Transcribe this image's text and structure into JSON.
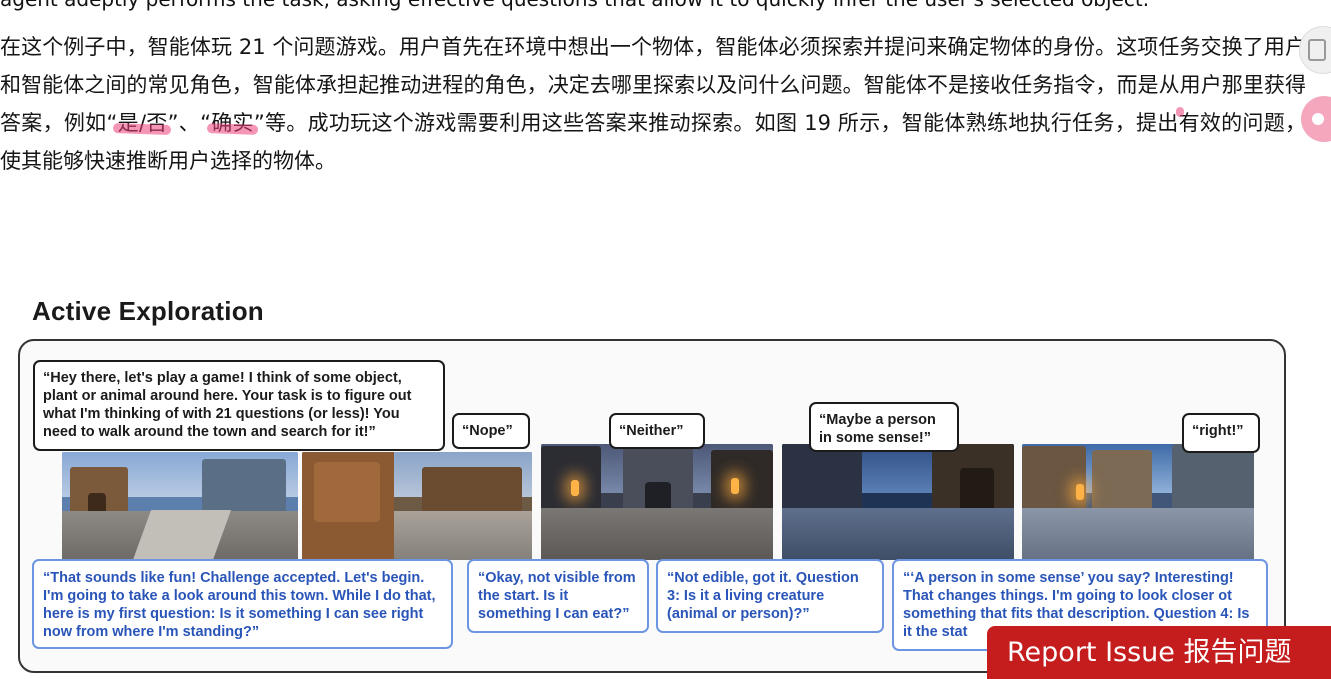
{
  "article": {
    "cut_line": "agent adeptly performs the task, asking effective questions that allow it to quickly infer the user's selected object.",
    "para_1": "在这个例子中，智能体玩 21 个问题游戏。用户首先在环境中想出一个物体，智能体必须探索并提问来确定物体的身份。这项任务交换了用户和智能体之间的常见角色，智能体承担起推动进程的角色，决定去哪里探索以及问什么问题。智能体不是接收任务指令，而是从",
    "para_hl_1": "用户那里获得答案",
    "para_2": "，例如“",
    "para_hl_2": "是/否",
    "para_3": "”、“",
    "para_hl_3": "确实",
    "para_4": "”等。成功玩这个游戏需要利用这些答案来推动探索。如图 19 所示，智能体熟练地执行任务，提出有效的问题，使其能够快速推断用户选择的物体。"
  },
  "figure": {
    "title": "Active Exploration",
    "user_bubbles": [
      "“Hey there, let's play a game! I think of some object, plant or animal around here. Your task is to figure out what I'm thinking of with 21 questions (or less)! You need to walk around the town and search for it!”",
      "“Nope”",
      "“Neither”",
      "“Maybe a person in some sense!”",
      "“right!”"
    ],
    "agent_bubbles": [
      "“That sounds like fun! Challenge accepted. Let's begin. I'm going to take a look around this town. While I do that, here is my first question: Is it something I can see right now from where I'm standing?”",
      "“Okay, not visible from the start. Is it something I can eat?”",
      "“Not edible, got it. Question 3: Is it a living creature (animal or person)?”",
      "“‘A person in some sense’ you say? Interesting! That changes things. I'm going to look closer ot something that fits that description. Question 4: Is it the stat"
    ]
  },
  "report_button": {
    "label": "Report Issue  报告问题"
  },
  "colors": {
    "highlight": "#ec407a",
    "agent_text": "#2a55b8",
    "agent_border": "#6d96e2",
    "report_bg": "#c51d1d"
  }
}
